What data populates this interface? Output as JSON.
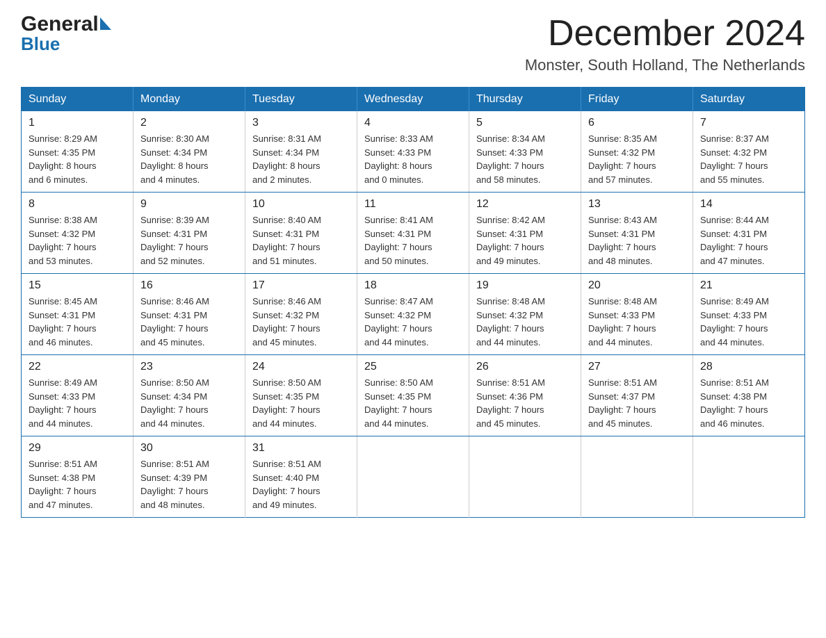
{
  "logo": {
    "general": "General",
    "blue": "Blue"
  },
  "header": {
    "month_year": "December 2024",
    "location": "Monster, South Holland, The Netherlands"
  },
  "days_of_week": [
    "Sunday",
    "Monday",
    "Tuesday",
    "Wednesday",
    "Thursday",
    "Friday",
    "Saturday"
  ],
  "weeks": [
    [
      {
        "day": "1",
        "sunrise": "8:29 AM",
        "sunset": "4:35 PM",
        "daylight": "8 hours and 6 minutes."
      },
      {
        "day": "2",
        "sunrise": "8:30 AM",
        "sunset": "4:34 PM",
        "daylight": "8 hours and 4 minutes."
      },
      {
        "day": "3",
        "sunrise": "8:31 AM",
        "sunset": "4:34 PM",
        "daylight": "8 hours and 2 minutes."
      },
      {
        "day": "4",
        "sunrise": "8:33 AM",
        "sunset": "4:33 PM",
        "daylight": "8 hours and 0 minutes."
      },
      {
        "day": "5",
        "sunrise": "8:34 AM",
        "sunset": "4:33 PM",
        "daylight": "7 hours and 58 minutes."
      },
      {
        "day": "6",
        "sunrise": "8:35 AM",
        "sunset": "4:32 PM",
        "daylight": "7 hours and 57 minutes."
      },
      {
        "day": "7",
        "sunrise": "8:37 AM",
        "sunset": "4:32 PM",
        "daylight": "7 hours and 55 minutes."
      }
    ],
    [
      {
        "day": "8",
        "sunrise": "8:38 AM",
        "sunset": "4:32 PM",
        "daylight": "7 hours and 53 minutes."
      },
      {
        "day": "9",
        "sunrise": "8:39 AM",
        "sunset": "4:31 PM",
        "daylight": "7 hours and 52 minutes."
      },
      {
        "day": "10",
        "sunrise": "8:40 AM",
        "sunset": "4:31 PM",
        "daylight": "7 hours and 51 minutes."
      },
      {
        "day": "11",
        "sunrise": "8:41 AM",
        "sunset": "4:31 PM",
        "daylight": "7 hours and 50 minutes."
      },
      {
        "day": "12",
        "sunrise": "8:42 AM",
        "sunset": "4:31 PM",
        "daylight": "7 hours and 49 minutes."
      },
      {
        "day": "13",
        "sunrise": "8:43 AM",
        "sunset": "4:31 PM",
        "daylight": "7 hours and 48 minutes."
      },
      {
        "day": "14",
        "sunrise": "8:44 AM",
        "sunset": "4:31 PM",
        "daylight": "7 hours and 47 minutes."
      }
    ],
    [
      {
        "day": "15",
        "sunrise": "8:45 AM",
        "sunset": "4:31 PM",
        "daylight": "7 hours and 46 minutes."
      },
      {
        "day": "16",
        "sunrise": "8:46 AM",
        "sunset": "4:31 PM",
        "daylight": "7 hours and 45 minutes."
      },
      {
        "day": "17",
        "sunrise": "8:46 AM",
        "sunset": "4:32 PM",
        "daylight": "7 hours and 45 minutes."
      },
      {
        "day": "18",
        "sunrise": "8:47 AM",
        "sunset": "4:32 PM",
        "daylight": "7 hours and 44 minutes."
      },
      {
        "day": "19",
        "sunrise": "8:48 AM",
        "sunset": "4:32 PM",
        "daylight": "7 hours and 44 minutes."
      },
      {
        "day": "20",
        "sunrise": "8:48 AM",
        "sunset": "4:33 PM",
        "daylight": "7 hours and 44 minutes."
      },
      {
        "day": "21",
        "sunrise": "8:49 AM",
        "sunset": "4:33 PM",
        "daylight": "7 hours and 44 minutes."
      }
    ],
    [
      {
        "day": "22",
        "sunrise": "8:49 AM",
        "sunset": "4:33 PM",
        "daylight": "7 hours and 44 minutes."
      },
      {
        "day": "23",
        "sunrise": "8:50 AM",
        "sunset": "4:34 PM",
        "daylight": "7 hours and 44 minutes."
      },
      {
        "day": "24",
        "sunrise": "8:50 AM",
        "sunset": "4:35 PM",
        "daylight": "7 hours and 44 minutes."
      },
      {
        "day": "25",
        "sunrise": "8:50 AM",
        "sunset": "4:35 PM",
        "daylight": "7 hours and 44 minutes."
      },
      {
        "day": "26",
        "sunrise": "8:51 AM",
        "sunset": "4:36 PM",
        "daylight": "7 hours and 45 minutes."
      },
      {
        "day": "27",
        "sunrise": "8:51 AM",
        "sunset": "4:37 PM",
        "daylight": "7 hours and 45 minutes."
      },
      {
        "day": "28",
        "sunrise": "8:51 AM",
        "sunset": "4:38 PM",
        "daylight": "7 hours and 46 minutes."
      }
    ],
    [
      {
        "day": "29",
        "sunrise": "8:51 AM",
        "sunset": "4:38 PM",
        "daylight": "7 hours and 47 minutes."
      },
      {
        "day": "30",
        "sunrise": "8:51 AM",
        "sunset": "4:39 PM",
        "daylight": "7 hours and 48 minutes."
      },
      {
        "day": "31",
        "sunrise": "8:51 AM",
        "sunset": "4:40 PM",
        "daylight": "7 hours and 49 minutes."
      },
      null,
      null,
      null,
      null
    ]
  ],
  "labels": {
    "sunrise": "Sunrise:",
    "sunset": "Sunset:",
    "daylight": "Daylight:"
  }
}
